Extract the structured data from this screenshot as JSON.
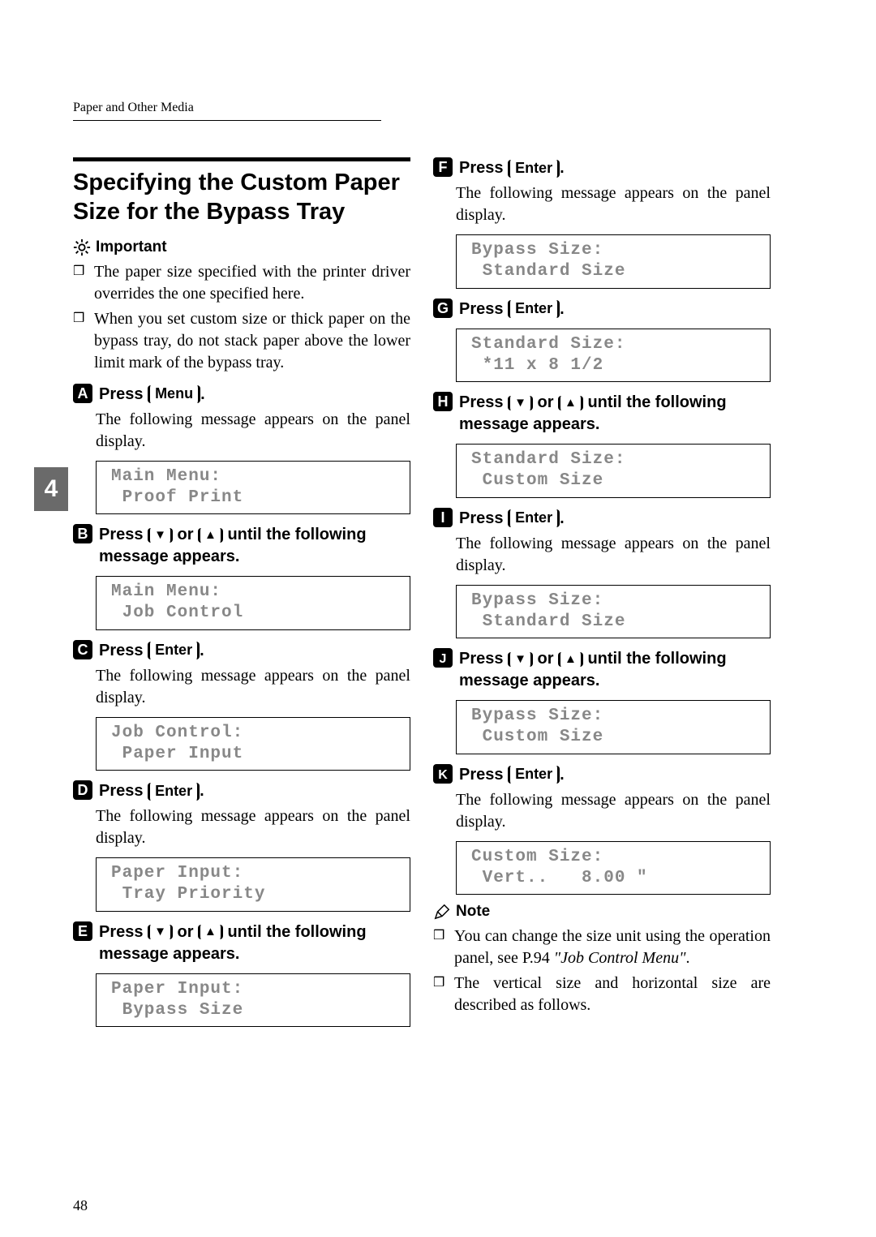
{
  "running_head": "Paper and Other Media",
  "side_tab": "4",
  "page_number": "48",
  "title": "Specifying the Custom Paper Size for the Bypass Tray",
  "important": {
    "label": "Important",
    "items": [
      "The paper size specified with the printer driver overrides the one specified here.",
      "When you set custom size or thick paper on the bypass tray, do not stack paper above the lower limit mark of the bypass tray."
    ]
  },
  "keys": {
    "menu": "Menu",
    "enter": "Enter",
    "down": "▼",
    "up": "▲"
  },
  "common": {
    "press": "Press ",
    "or": " or ",
    "until": " until the following message appears.",
    "period": ".",
    "panel_msg": "The following message appears on the panel display."
  },
  "steps": {
    "s1": {
      "num": "1",
      "panel": "Main Menu:\n Proof Print"
    },
    "s2": {
      "num": "2",
      "panel": "Main Menu:\n Job Control"
    },
    "s3": {
      "num": "3",
      "panel": "Job Control:\n Paper Input"
    },
    "s4": {
      "num": "4",
      "panel": "Paper Input:\n Tray Priority"
    },
    "s5": {
      "num": "5",
      "panel": "Paper Input:\n Bypass Size"
    },
    "s6": {
      "num": "6",
      "panel": "Bypass Size:\n Standard Size"
    },
    "s7": {
      "num": "7",
      "panel": "Standard Size:\n *11 x 8 1/2"
    },
    "s8": {
      "num": "8",
      "panel": "Standard Size:\n Custom Size"
    },
    "s9": {
      "num": "9",
      "panel": "Bypass Size:\n Standard Size"
    },
    "s10": {
      "num": "10",
      "panel": "Bypass Size:\n Custom Size"
    },
    "s11": {
      "num": "11",
      "panel": "Custom Size:\n Vert..   8.00 \""
    }
  },
  "note": {
    "label": "Note",
    "items_pre": "You can change the size unit using the operation panel, see P.94 ",
    "items_ref": "\"Job Control Menu\"",
    "items_post": ".",
    "item2": "The vertical size and horizontal size are described as follows."
  }
}
